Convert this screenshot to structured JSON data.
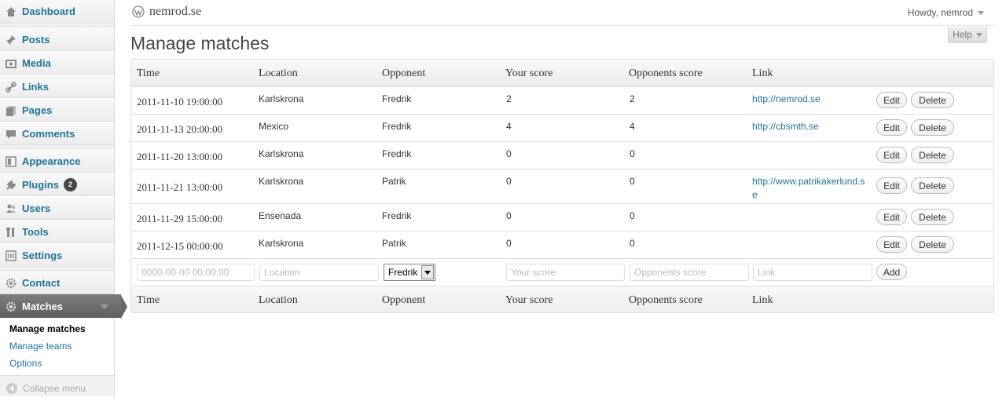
{
  "site": {
    "title": "nemrod.se",
    "howdy": "Howdy, nemrod",
    "help": "Help"
  },
  "page": {
    "title": "Manage matches"
  },
  "sidebar": {
    "items": [
      {
        "label": "Dashboard",
        "icon": "dashboard-icon"
      },
      {
        "label": "Posts",
        "icon": "pin-icon"
      },
      {
        "label": "Media",
        "icon": "media-icon"
      },
      {
        "label": "Links",
        "icon": "link-icon"
      },
      {
        "label": "Pages",
        "icon": "pages-icon"
      },
      {
        "label": "Comments",
        "icon": "comment-icon"
      },
      {
        "label": "Appearance",
        "icon": "appearance-icon"
      },
      {
        "label": "Plugins",
        "icon": "plug-icon",
        "badge": "2"
      },
      {
        "label": "Users",
        "icon": "users-icon"
      },
      {
        "label": "Tools",
        "icon": "tools-icon"
      },
      {
        "label": "Settings",
        "icon": "settings-icon"
      },
      {
        "label": "Contact",
        "icon": "gear-icon"
      },
      {
        "label": "Matches",
        "icon": "gear-icon"
      }
    ],
    "submenu": [
      "Manage matches",
      "Manage teams",
      "Options"
    ],
    "collapse": "Collapse menu"
  },
  "table": {
    "columns": [
      "Time",
      "Location",
      "Opponent",
      "Your score",
      "Opponents score",
      "Link"
    ],
    "rows": [
      {
        "time": "2011-11-10 19:00:00",
        "location": "Karlskrona",
        "opponent": "Fredrik",
        "your": "2",
        "opp": "2",
        "link": "http://nemrod.se"
      },
      {
        "time": "2011-11-13 20:00:00",
        "location": "Mexico",
        "opponent": "Fredrik",
        "your": "4",
        "opp": "4",
        "link": "http://cbsmth.se"
      },
      {
        "time": "2011-11-20 13:00:00",
        "location": "Karlskrona",
        "opponent": "Fredrik",
        "your": "0",
        "opp": "0",
        "link": ""
      },
      {
        "time": "2011-11-21 13:00:00",
        "location": "Karlskrona",
        "opponent": "Patrik",
        "your": "0",
        "opp": "0",
        "link": "http://www.patrikakerlund.se"
      },
      {
        "time": "2011-11-29 15:00:00",
        "location": "Ensenada",
        "opponent": "Fredrik",
        "your": "0",
        "opp": "0",
        "link": ""
      },
      {
        "time": "2011-12-15 00:00:00",
        "location": "Karlskrona",
        "opponent": "Patrik",
        "your": "0",
        "opp": "0",
        "link": ""
      }
    ],
    "edit_label": "Edit",
    "delete_label": "Delete",
    "add_form": {
      "time_placeholder": "0000-00-00 00:00:00",
      "location_placeholder": "Location",
      "opponent_selected": "Fredrik",
      "your_placeholder": "Your score",
      "opp_placeholder": "Opponents score",
      "link_placeholder": "Link",
      "add_label": "Add"
    }
  },
  "colors": {
    "link": "#21759b",
    "current_menu": "#6a6a6a",
    "badge": "#464646"
  }
}
